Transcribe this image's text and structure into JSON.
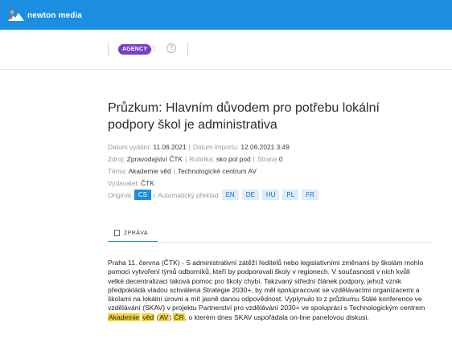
{
  "app": {
    "logo_text": "newton media"
  },
  "toolbar": {
    "agency_badge": "AGENCY",
    "star_icon": "star-icon",
    "help_icon": "help-icon",
    "help_glyph": "?"
  },
  "article": {
    "title": "Průzkum: Hlavním důvodem pro potřebu lokální podpory škol je administrativa",
    "meta": {
      "release_label": "Datum vydání:",
      "release_value": "11.06.2021",
      "import_label": "Datum importu:",
      "import_value": "12.06.2021 3:49",
      "source_label": "Zdroj:",
      "source_value": "Zpravodajství ČTK",
      "rubric_label": "Rubrika:",
      "rubric_value": "sko pol pod",
      "page_label": "Strana",
      "page_value": "0",
      "topic_label": "Téma:",
      "topic_value_1": "Akademie věd",
      "topic_value_2": "Technologické centrum AV",
      "publisher_label": "Vydavatel:",
      "publisher_value": "ČTK",
      "original_label": "Originál",
      "original_lang": "CS",
      "auto_translate_label": "Automatický překlad",
      "translations": [
        "EN",
        "DE",
        "HU",
        "PL",
        "FR"
      ]
    },
    "tab_label": "ZPRÁVA",
    "body": {
      "text_1": "Praha 11. června (ČTK) - S administrativní zátěží ředitelů nebo legislativními změnami by školám mohlo pomoci vytvoření týmů odborníků, kteří by podporovali školy v regionech. V současnosti v nich kvůli velké decentralizaci taková pomoc pro školy chybí. Takzvaný střední článek podpory, jehož vznik předpokládá vládou schválená Strategie 2030+, by měl spolupracovat se vzdělávacími organizacemi a školami na lokální úrovni a mít jasně danou odpovědnost. Vyplynulo to z průzkumu Stálé konference ve vzdělávání (SKAV) v projektu Partnerství pro vzdělávání 2030+ ve spolupráci s Technologickým centrem ",
      "hl_1": "Akademie",
      "hl_2": "věd",
      "paren_open": "(",
      "hl_3": "AV",
      "paren_close": ")",
      "hl_4": "ČR",
      "text_2": ", o kterém dnes SKAV uspořádala on-line panelovou diskusi."
    }
  },
  "colors": {
    "brand": "#1b8ee0",
    "agency": "#7a3fc4",
    "highlight": "#f5d53a"
  }
}
